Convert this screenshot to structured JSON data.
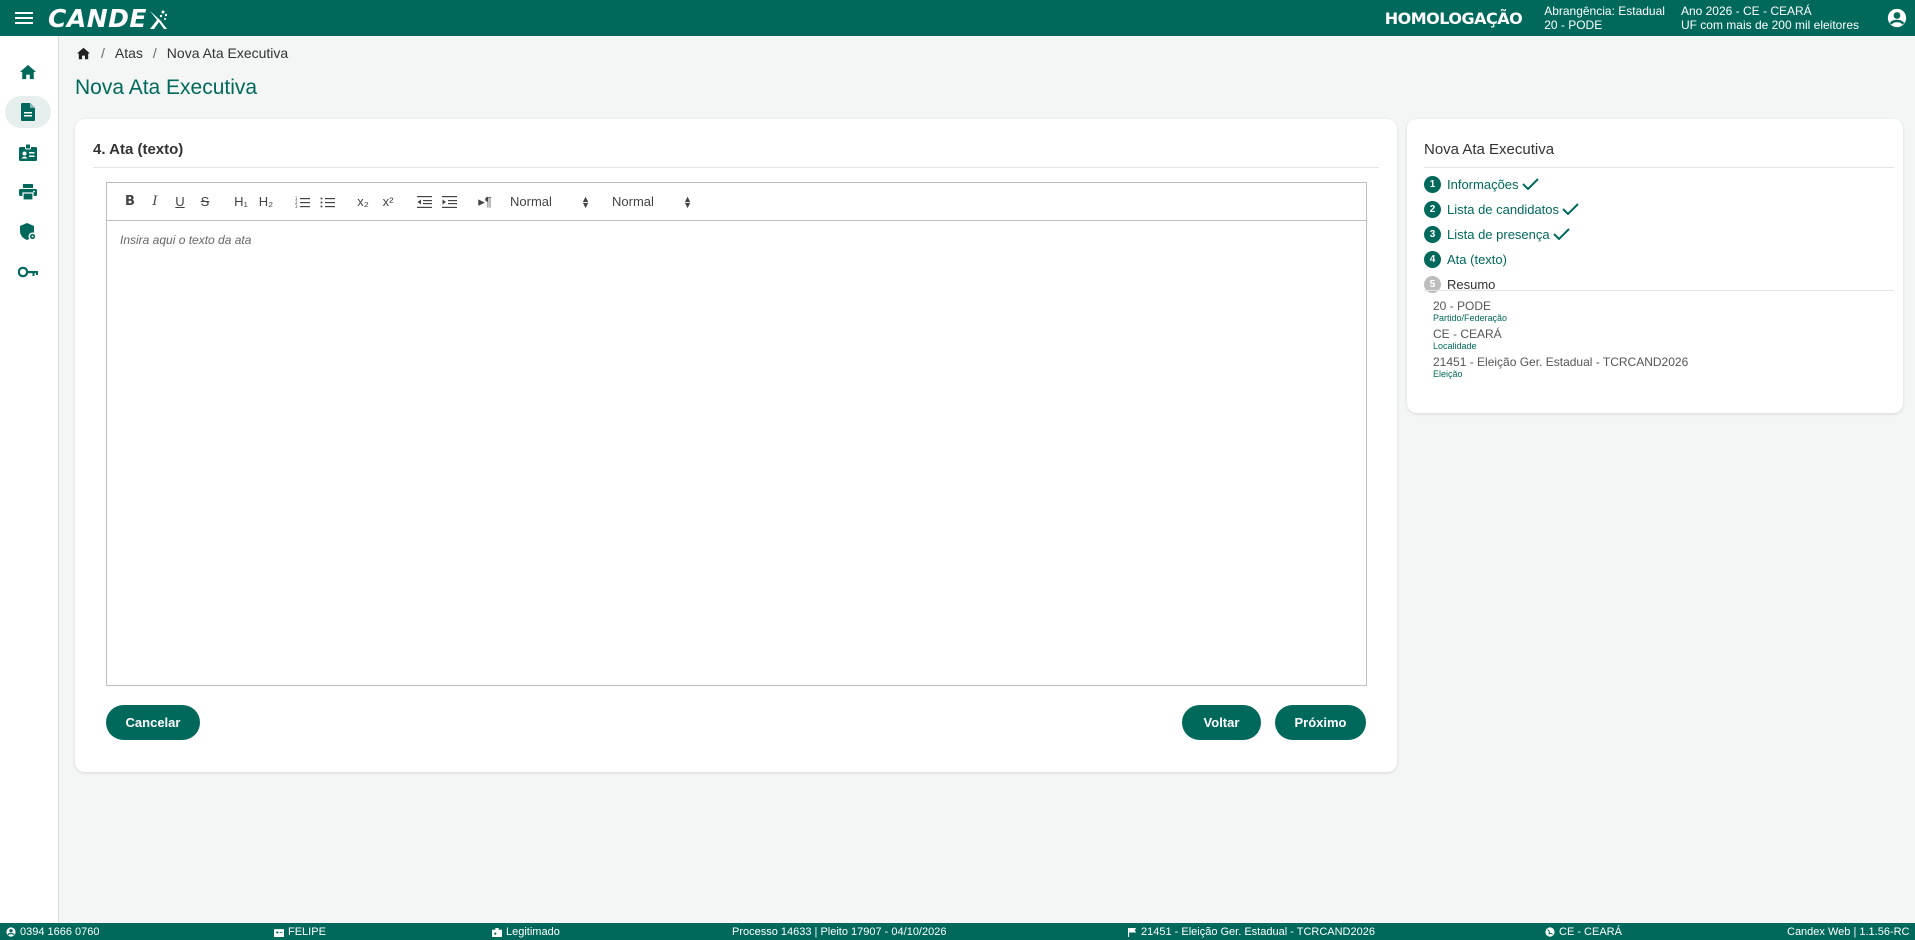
{
  "header": {
    "logo": "CANDE",
    "environment": "HOMOLOGAÇÃO",
    "scope_line1": "Abrangência: Estadual",
    "scope_line2": "20 - PODE",
    "year_line1": "Ano 2026 - CE - CEARÁ",
    "year_line2": "UF com mais de 200 mil eleitores"
  },
  "sidebar": {
    "items": [
      {
        "icon": "home-icon"
      },
      {
        "icon": "document-icon",
        "active": true
      },
      {
        "icon": "badge-icon"
      },
      {
        "icon": "printer-icon"
      },
      {
        "icon": "shield-settings-icon"
      },
      {
        "icon": "key-icon"
      }
    ]
  },
  "breadcrumb": {
    "items": [
      "Atas",
      "Nova Ata Executiva"
    ]
  },
  "page": {
    "title": "Nova Ata Executiva"
  },
  "main": {
    "section_title": "4. Ata (texto)",
    "toolbar": {
      "bold": "B",
      "italic": "I",
      "underline": "U",
      "strike": "S",
      "h1": "H₁",
      "h2": "H₂",
      "sub": "x₂",
      "sup": "x²",
      "rtl": "▸¶",
      "select1": "Normal",
      "select2": "Normal"
    },
    "editor_placeholder": "Insira aqui o texto da ata",
    "buttons": {
      "cancel": "Cancelar",
      "back": "Voltar",
      "next": "Próximo"
    }
  },
  "side": {
    "title": "Nova Ata Executiva",
    "steps": [
      {
        "num": "1",
        "label": "Informações",
        "done": true
      },
      {
        "num": "2",
        "label": "Lista de candidatos",
        "done": true
      },
      {
        "num": "3",
        "label": "Lista de presença",
        "done": true
      },
      {
        "num": "4",
        "label": "Ata (texto)",
        "done": false
      },
      {
        "num": "5",
        "label": "Resumo",
        "done": false
      }
    ],
    "summary": [
      {
        "value": "20 - PODE",
        "label": "Partido/Federação"
      },
      {
        "value": "CE - CEARÁ",
        "label": "Localidade"
      },
      {
        "value": "21451 - Eleição Ger. Estadual - TCRCAND2026",
        "label": "Eleição"
      }
    ]
  },
  "footer": {
    "id": "0394 1666 0760",
    "user": "FELIPE",
    "role": "Legitimado",
    "process": "Processo 14633 | Pleito 17907 - 04/10/2026",
    "election": "21451 - Eleição Ger. Estadual - TCRCAND2026",
    "locality": "CE - CEARÁ",
    "version": "Candex Web | 1.1.56-RC"
  },
  "colors": {
    "primary": "#00695c",
    "background": "#f4f6f5",
    "step_pending": "#bdbdbd"
  }
}
